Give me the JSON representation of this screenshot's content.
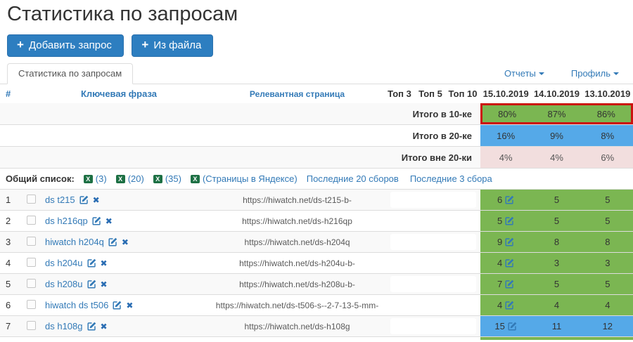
{
  "page": {
    "title": "Статистика по запросам"
  },
  "toolbar": {
    "add_query": "Добавить запрос",
    "from_file": "Из файла"
  },
  "nav": {
    "tab": "Статистика по запросам",
    "reports": "Отчеты",
    "profile": "Профиль"
  },
  "icons": {
    "plus": "+",
    "delete": "✖",
    "excel_letter": "X"
  },
  "colors": {
    "accent_link": "#337ab7",
    "button": "#2d7ec0",
    "top10_green": "#7bb652",
    "top20_blue": "#55a9e8",
    "out20_pink": "#f2dede",
    "highlight_red": "#cb1210"
  },
  "table": {
    "headers": {
      "num": "#",
      "phrase": "Ключевая фраза",
      "page": "Релевантная страница",
      "top3": "Топ 3",
      "top5": "Топ 5",
      "top10": "Топ 10",
      "dates": [
        "15.10.2019",
        "14.10.2019",
        "13.10.2019"
      ]
    },
    "summary": [
      {
        "label": "Итого в 10-ке",
        "values": [
          "80%",
          "87%",
          "86%"
        ],
        "style": "green",
        "highlighted": true
      },
      {
        "label": "Итого в 20-ке",
        "values": [
          "16%",
          "9%",
          "8%"
        ],
        "style": "blue",
        "highlighted": false
      },
      {
        "label": "Итого вне 20-ки",
        "values": [
          "4%",
          "4%",
          "6%"
        ],
        "style": "pink",
        "highlighted": false
      }
    ],
    "listbar": {
      "label": "Общий список:",
      "excel_links": [
        "(3)",
        "(20)",
        "(35)",
        "(Страницы в Яндексе)"
      ],
      "links": [
        "Последние 20 сборов",
        "Последние 3 сбора"
      ]
    },
    "rows": [
      {
        "num": "1",
        "phrase": "ds t215",
        "url": "https://hiwatch.net/ds-t215-b-",
        "values": [
          "6",
          "5",
          "5"
        ],
        "style": "green"
      },
      {
        "num": "2",
        "phrase": "ds h216qp",
        "url": "https://hiwatch.net/ds-h216qp",
        "values": [
          "5",
          "5",
          "5"
        ],
        "style": "green"
      },
      {
        "num": "3",
        "phrase": "hiwatch h204q",
        "url": "https://hiwatch.net/ds-h204q",
        "values": [
          "9",
          "8",
          "8"
        ],
        "style": "green"
      },
      {
        "num": "4",
        "phrase": "ds h204u",
        "url": "https://hiwatch.net/ds-h204u-b-",
        "values": [
          "4",
          "3",
          "3"
        ],
        "style": "green"
      },
      {
        "num": "5",
        "phrase": "ds h208u",
        "url": "https://hiwatch.net/ds-h208u-b-",
        "values": [
          "7",
          "5",
          "5"
        ],
        "style": "green"
      },
      {
        "num": "6",
        "phrase": "hiwatch ds t506",
        "url": "https://hiwatch.net/ds-t506-s--2-7-13-5-mm-",
        "values": [
          "4",
          "4",
          "4"
        ],
        "style": "green"
      },
      {
        "num": "7",
        "phrase": "ds h108g",
        "url": "https://hiwatch.net/ds-h108g",
        "values": [
          "15",
          "11",
          "12"
        ],
        "style": "blue"
      }
    ]
  }
}
